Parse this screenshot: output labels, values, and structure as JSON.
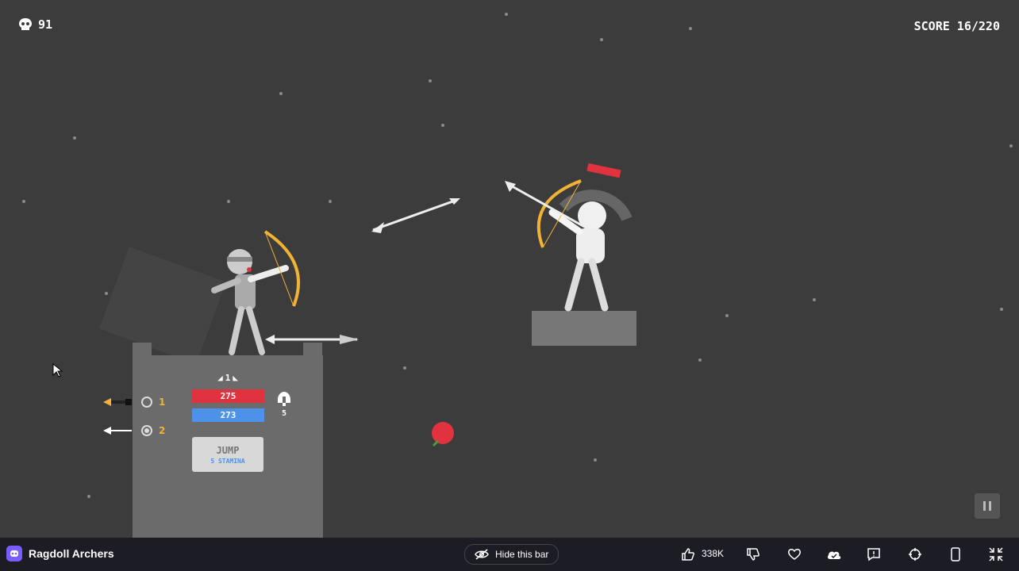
{
  "hud": {
    "kills": "91",
    "score": "SCORE 16/220"
  },
  "player": {
    "level": "1",
    "hp": "275",
    "stamina": "273",
    "helmet_count": "5",
    "jump_label": "JUMP",
    "jump_cost": "5 STAMINA",
    "arrow_options": [
      {
        "number": "1",
        "selected": false
      },
      {
        "number": "2",
        "selected": true
      }
    ]
  },
  "bottombar": {
    "title": "Ragdoll Archers",
    "hide_label": "Hide this bar",
    "likes": "338K"
  },
  "colors": {
    "background": "#3c3c3c",
    "bow": "#f2b233",
    "health": "#e0323f",
    "stamina": "#4b92e8",
    "bar": "#1c1c24",
    "brand": "#7b5cff"
  }
}
